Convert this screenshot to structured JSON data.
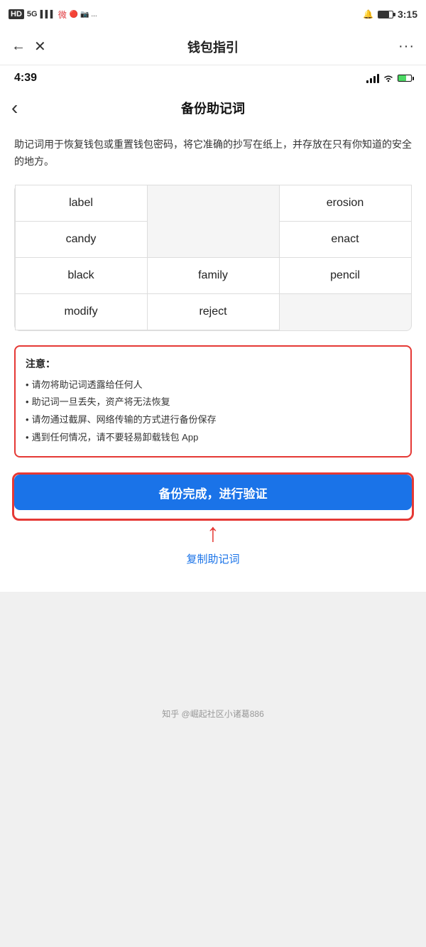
{
  "outer_status_bar": {
    "left_icons": "HD 5G 信号图标",
    "time": "3:15",
    "battery": "75%"
  },
  "top_nav": {
    "back_icon": "←",
    "close_icon": "✕",
    "title": "钱包指引",
    "more_icon": "···"
  },
  "inner_status_bar": {
    "time": "4:39"
  },
  "inner_page": {
    "back_icon": "‹",
    "title": "备份助记词"
  },
  "description": "助记词用于恢复钱包或重置钱包密码，将它准确的抄写在纸上，并存放在只有你知道的安全的地方。",
  "mnemonic_words": [
    {
      "word": "label",
      "col": 0,
      "row": 0
    },
    {
      "word": "",
      "col": 1,
      "row": 0
    },
    {
      "word": "erosion",
      "col": 2,
      "row": 0
    },
    {
      "word": "candy",
      "col": 0,
      "row": 1
    },
    {
      "word": "",
      "col": 1,
      "row": 1
    },
    {
      "word": "enact",
      "col": 2,
      "row": 1
    },
    {
      "word": "black",
      "col": 0,
      "row": 2
    },
    {
      "word": "family",
      "col": 1,
      "row": 2
    },
    {
      "word": "pencil",
      "col": 2,
      "row": 2
    },
    {
      "word": "modify",
      "col": 0,
      "row": 3
    },
    {
      "word": "reject",
      "col": 1,
      "row": 3
    },
    {
      "word": "",
      "col": 2,
      "row": 3
    }
  ],
  "warning": {
    "title": "注意：",
    "items": [
      "请勿将助记词透露给任何人",
      "助记词一旦丢失，资产将无法恢复",
      "请勿通过截屏、网络传输的方式进行备份保存",
      "遇到任何情况，请不要轻易卸载钱包 App"
    ]
  },
  "verify_button": "备份完成，进行验证",
  "copy_link": "复制助记词",
  "watermark": "知乎 @崛起社区小诸葛886"
}
